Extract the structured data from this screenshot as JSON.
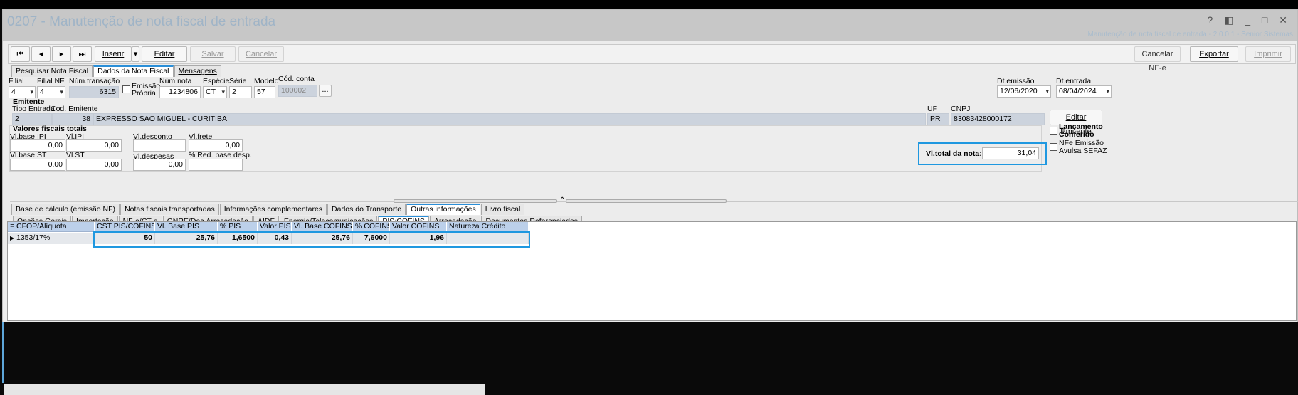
{
  "window": {
    "title": "0207 - Manutenção de nota fiscal de entrada",
    "controls": "? ◧ _ □ ✕",
    "subtitle": "Manutenção de nota fiscal de entrada - 2.0.0.1 - Senior Sistemas"
  },
  "toolbar": {
    "first": "⏮",
    "prev": "◂",
    "next": "▸",
    "last": "⏭",
    "insert": "Inserir",
    "insert_dd": "▾",
    "edit": "Editar",
    "save": "Salvar",
    "cancel": "Cancelar",
    "cancel_nfe": "Cancelar NF-e",
    "export": "Exportar",
    "print": "Imprimir"
  },
  "main_tabs": [
    "Pesquisar Nota Fiscal",
    "Dados da Nota Fiscal",
    "Mensagens"
  ],
  "header": {
    "filial_label": "Filial",
    "filial": "4",
    "filialnf_label": "Filial NF",
    "filialnf": "4",
    "numtrans_label": "Núm.transação",
    "numtrans": "6315",
    "emissao_label": "Emissão Própria",
    "numnota_label": "Núm.nota",
    "numnota": "1234806",
    "especie_label": "Espécie",
    "especie": "CT",
    "serie_label": "Série",
    "serie": "2",
    "modelo_label": "Modelo",
    "modelo": "57",
    "codconta_label": "Cód. conta",
    "codconta": "100002",
    "codconta_btn": "...",
    "dtemissao_label": "Dt.emissão",
    "dtemissao": "12/06/2020",
    "dtentrada_label": "Dt.entrada",
    "dtentrada": "08/04/2024"
  },
  "emitente": {
    "section": "Emitente",
    "tipo_label": "Tipo Entrada",
    "tipo": "2",
    "cod_label": "Cod. Emitente",
    "cod": "38",
    "nome": "EXPRESSO SAO MIGUEL - CURITIBA",
    "uf_label": "UF",
    "uf": "PR",
    "cnpj_label": "CNPJ",
    "cnpj": "83083428000172",
    "edit_button": "Editar Emitente"
  },
  "valores": {
    "section": "Valores fiscais totais",
    "base_ipi_label": "Vl.base IPI",
    "base_ipi": "0,00",
    "ipi_label": "Vl.IPI",
    "ipi": "0,00",
    "desconto_label": "Vl.desconto",
    "desconto": "",
    "frete_label": "Vl.frete",
    "frete": "0,00",
    "base_st_label": "Vl.base ST",
    "base_st": "0,00",
    "st_label": "Vl.ST",
    "st": "0,00",
    "despesas_label": "Vl.despesas",
    "despesas": "0,00",
    "red_label": "% Red. base desp.",
    "red": "",
    "total_label": "Vl.total da nota:",
    "total": "31,04",
    "lanc_label": "Lançamento Conferido",
    "nfe_label": "NFe Emissão Avulsa SEFAZ"
  },
  "sub_tabs": [
    "Base de cálculo (emissão NF)",
    "Notas fiscais transportadas",
    "Informações complementares",
    "Dados do Transporte",
    "Outras informações",
    "Livro fiscal"
  ],
  "sub_tabs2": [
    "Opções Gerais",
    "Importação",
    "NF-e/CT-e",
    "GNRE/Doc.Arrecadação",
    "AIDF",
    "Energia/Telecomunicações",
    "PIS/COFINS",
    "Arrecadação",
    "Documentos Referenciados"
  ],
  "grid": {
    "columns": [
      "CFOP/Alíquota",
      "CST PIS/COFINS",
      "Vl. Base PIS",
      "% PIS",
      "Valor PIS",
      "Vl. Base COFINS",
      "% COFINS",
      "Valor COFINS",
      "Natureza Crédito"
    ],
    "rows": [
      [
        "1353/17%",
        "50",
        "25,76",
        "1,6500",
        "0,43",
        "25,76",
        "7,6000",
        "1,96",
        ""
      ]
    ]
  }
}
